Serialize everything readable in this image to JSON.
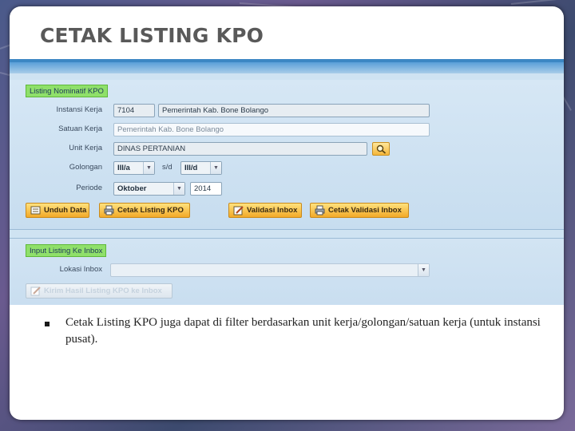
{
  "slide": {
    "title": "CETAK LISTING KPO",
    "bullet": "Cetak Listing KPO juga dapat di filter berdasarkan unit kerja/golongan/satuan kerja (untuk instansi pusat)."
  },
  "form": {
    "section1_legend": "Listing Nominatif KPO",
    "instansi": {
      "label": "Instansi Kerja",
      "code": "7104",
      "name": "Pemerintah Kab. Bone Bolango"
    },
    "satuan": {
      "label": "Satuan Kerja",
      "value": "Pemerintah Kab. Bone Bolango"
    },
    "unit": {
      "label": "Unit Kerja",
      "value": "DINAS PERTANIAN"
    },
    "golongan": {
      "label": "Golongan",
      "from": "III/a",
      "separator": "s/d",
      "to": "III/d"
    },
    "periode": {
      "label": "Periode",
      "month": "Oktober",
      "year": "2014"
    },
    "buttons": {
      "unduh": "Unduh Data",
      "cetak_listing": "Cetak Listing KPO",
      "validasi_inbox": "Validasi Inbox",
      "cetak_validasi": "Cetak Validasi Inbox"
    },
    "section2_legend": "Input Listing Ke Inbox",
    "lokasi": {
      "label": "Lokasi Inbox",
      "value": ""
    },
    "kirim_button": "Kirim Hasil Listing KPO ke Inbox"
  },
  "colors": {
    "legend_bg": "#8fe06a",
    "button_gradient_top": "#ffe27e",
    "button_gradient_bottom": "#f2a928",
    "panel_bg": "#cfe3f2",
    "title_color": "#595959"
  }
}
